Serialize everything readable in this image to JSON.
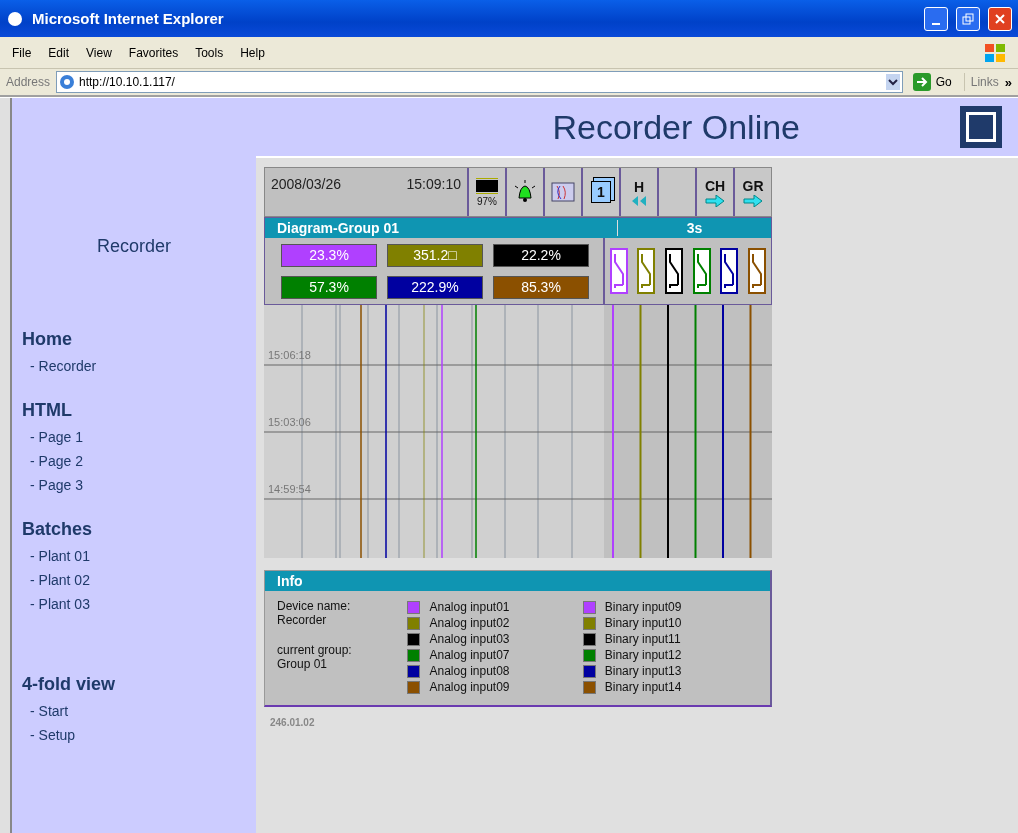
{
  "window": {
    "title": "Microsoft Internet Explorer"
  },
  "menu": [
    "File",
    "Edit",
    "View",
    "Favorites",
    "Tools",
    "Help"
  ],
  "address": {
    "label": "Address",
    "value": "http://10.10.1.117/",
    "go": "Go",
    "links": "Links",
    "more": "»"
  },
  "sidebar": {
    "title": "Recorder",
    "sections": [
      {
        "heading": "Home",
        "items": [
          "- Recorder"
        ]
      },
      {
        "heading": "HTML",
        "items": [
          "- Page 1",
          "- Page 2",
          "- Page 3"
        ]
      },
      {
        "heading": "Batches",
        "items": [
          "- Plant 01",
          "- Plant 02",
          "- Plant 03"
        ]
      },
      {
        "heading": "4-fold view",
        "items": [
          "- Start",
          "- Setup"
        ]
      }
    ]
  },
  "header": {
    "title": "Recorder Online"
  },
  "recorder": {
    "date": "2008/03/26",
    "time": "15:09:10",
    "toolbar": [
      {
        "kind": "memory",
        "label": "97%"
      },
      {
        "kind": "alarm"
      },
      {
        "kind": "diagram"
      },
      {
        "kind": "pages",
        "label": "1"
      },
      {
        "kind": "history",
        "label": "H"
      },
      {
        "kind": "blank"
      },
      {
        "kind": "next",
        "label": "CH"
      },
      {
        "kind": "next",
        "label": "GR"
      }
    ],
    "group": "Diagram-Group 01",
    "interval": "3s",
    "channels": [
      {
        "value": "23.3%",
        "color": "#b040ff"
      },
      {
        "value": "351.2□",
        "color": "#808000"
      },
      {
        "value": "22.2%",
        "color": "#000000"
      },
      {
        "value": "57.3%",
        "color": "#008000"
      },
      {
        "value": "222.9%",
        "color": "#0000a0"
      },
      {
        "value": "85.3%",
        "color": "#8b5000"
      }
    ],
    "time_labels": [
      "15:06:18",
      "15:03:06",
      "14:59:54"
    ],
    "info": {
      "title": "Info",
      "device_label": "Device name:",
      "device": "Recorder",
      "group_label": "current group:",
      "group": "Group 01",
      "analog": [
        {
          "name": "Analog input01",
          "color": "#b040ff"
        },
        {
          "name": "Analog input02",
          "color": "#808000"
        },
        {
          "name": "Analog input03",
          "color": "#000000"
        },
        {
          "name": "Analog input07",
          "color": "#008000"
        },
        {
          "name": "Analog input08",
          "color": "#0000a0"
        },
        {
          "name": "Analog input09",
          "color": "#8b5000"
        }
      ],
      "binary": [
        {
          "name": "Binary input09",
          "color": "#b040ff"
        },
        {
          "name": "Binary input10",
          "color": "#808000"
        },
        {
          "name": "Binary input11",
          "color": "#000000"
        },
        {
          "name": "Binary input12",
          "color": "#008000"
        },
        {
          "name": "Binary input13",
          "color": "#0000a0"
        },
        {
          "name": "Binary input14",
          "color": "#8b5000"
        }
      ]
    },
    "version": "246.01.02"
  }
}
